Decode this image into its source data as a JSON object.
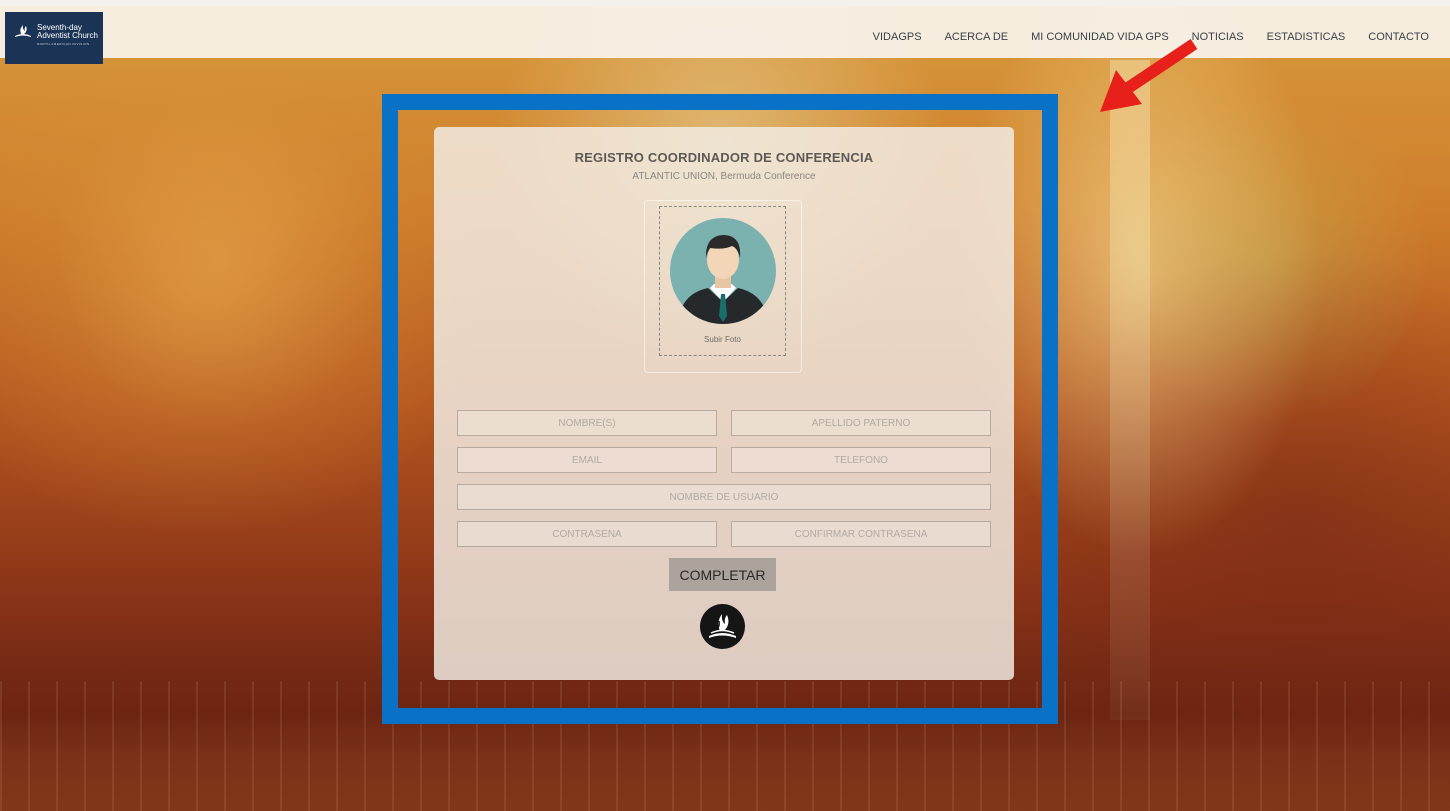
{
  "header": {
    "logo": {
      "line1": "Seventh-day",
      "line2": "Adventist Church",
      "line3": "NORTH AMERICAN DIVISION"
    },
    "nav": [
      {
        "label": "VIDAGPS"
      },
      {
        "label": "ACERCA DE"
      },
      {
        "label": "MI COMUNIDAD VIDA GPS"
      },
      {
        "label": "NOTICIAS"
      },
      {
        "label": "ESTADISTICAS"
      },
      {
        "label": "CONTACTO"
      }
    ]
  },
  "form": {
    "title": "REGISTRO COORDINADOR DE CONFERENCIA",
    "subtitle": "ATLANTIC UNION, Bermuda Conference",
    "upload_label": "Subir Foto",
    "fields": {
      "first_name": {
        "placeholder": "NOMBRE(S)",
        "value": ""
      },
      "last_name": {
        "placeholder": "APELLIDO PATERNO",
        "value": ""
      },
      "email": {
        "placeholder": "EMAIL",
        "value": ""
      },
      "phone": {
        "placeholder": "TELEFONO",
        "value": ""
      },
      "username": {
        "placeholder": "NOMBRE DE USUARIO",
        "value": ""
      },
      "password": {
        "placeholder": "CONTRASEÑA",
        "value": ""
      },
      "confirm_password": {
        "placeholder": "CONFIRMAR CONTRASEÑA",
        "value": ""
      }
    },
    "submit_label": "COMPLETAR"
  },
  "colors": {
    "frame": "#0a72c6",
    "arrow": "#e8201b",
    "logo_bg": "#1b3456",
    "button_bg": "#aca49c"
  },
  "icons": {
    "logo": "sda-flame-book-icon",
    "avatar": "user-avatar-icon",
    "arrow": "red-arrow-icon",
    "church": "sda-church-logo-icon"
  }
}
